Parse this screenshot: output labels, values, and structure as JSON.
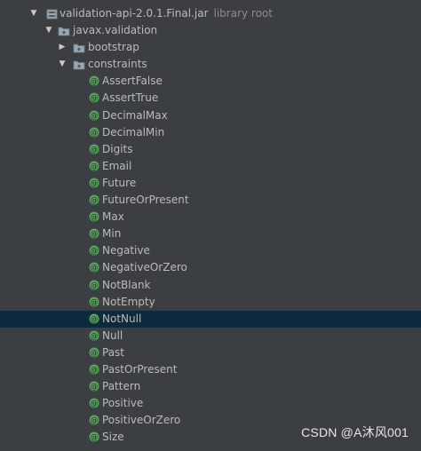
{
  "tree": {
    "jar": {
      "name": "validation-api-2.0.1.Final.jar",
      "hint": "library root"
    },
    "package": {
      "name": "javax.validation"
    },
    "subpackages": [
      {
        "name": "bootstrap",
        "expanded": false
      },
      {
        "name": "constraints",
        "expanded": true
      }
    ],
    "annotations": [
      "AssertFalse",
      "AssertTrue",
      "DecimalMax",
      "DecimalMin",
      "Digits",
      "Email",
      "Future",
      "FutureOrPresent",
      "Max",
      "Min",
      "Negative",
      "NegativeOrZero",
      "NotBlank",
      "NotEmpty",
      "NotNull",
      "Null",
      "Past",
      "PastOrPresent",
      "Pattern",
      "Positive",
      "PositiveOrZero",
      "Size"
    ],
    "selected": "NotNull"
  },
  "watermark": "CSDN @A沐风001",
  "colors": {
    "background": "#3c3f41",
    "selection": "#0d293e",
    "text": "#bbbbbb",
    "hint": "#8c8c8c",
    "annotation_icon": "#57a55a"
  }
}
